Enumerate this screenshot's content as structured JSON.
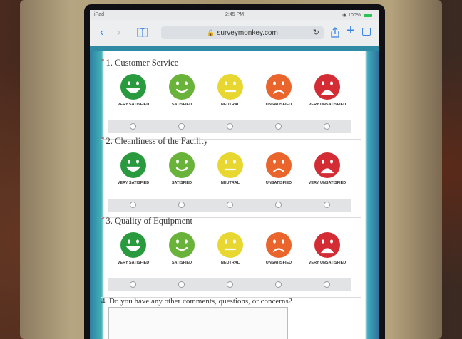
{
  "status": {
    "device": "iPad",
    "time": "2:45 PM",
    "battery": "100%"
  },
  "browser": {
    "url": "surveymonkey.com"
  },
  "rating_labels": [
    "VERY SATISFIED",
    "SATISFIED",
    "NEUTRAL",
    "UNSATISFIED",
    "VERY UNSATISFIED"
  ],
  "rating_colors": [
    "#2a9a3e",
    "#6ab33a",
    "#e8d730",
    "#e9652c",
    "#d42c34"
  ],
  "questions": [
    {
      "required": "*",
      "title": "1. Customer Service"
    },
    {
      "required": "*",
      "title": "2. Cleanliness of the Facility"
    },
    {
      "required": "*",
      "title": "3. Quality of Equipment"
    },
    {
      "title": "4. Do you have any other comments, questions, or concerns?"
    }
  ]
}
